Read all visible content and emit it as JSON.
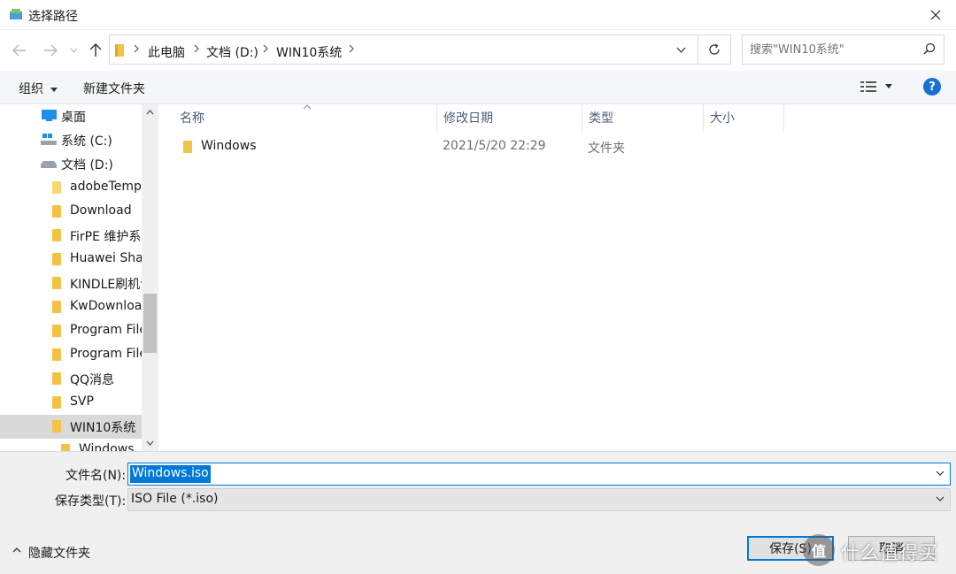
{
  "window": {
    "title": "选择路径"
  },
  "address": {
    "crumbs": [
      "此电脑",
      "文档 (D:)",
      "WIN10系统"
    ]
  },
  "search": {
    "placeholder": "搜索\"WIN10系统\""
  },
  "toolbar": {
    "organize": "组织",
    "new_folder": "新建文件夹",
    "help": "?"
  },
  "nav": {
    "items": [
      {
        "label": "桌面",
        "icon": "desktop-icon"
      },
      {
        "label": "系统 (C:)",
        "icon": "system-drive-icon"
      },
      {
        "label": "文档 (D:)",
        "icon": "drive-icon"
      },
      {
        "label": "adobeTemp",
        "icon": "folder-icon"
      },
      {
        "label": "Download",
        "icon": "folder-icon"
      },
      {
        "label": "FirPE 维护系统",
        "icon": "folder-icon"
      },
      {
        "label": "Huawei Share",
        "icon": "folder-icon"
      },
      {
        "label": "KINDLE刷机包",
        "icon": "folder-icon"
      },
      {
        "label": "KwDownload",
        "icon": "folder-icon"
      },
      {
        "label": "Program Files",
        "icon": "folder-icon"
      },
      {
        "label": "Program Files",
        "icon": "folder-icon"
      },
      {
        "label": "QQ消息",
        "icon": "folder-icon"
      },
      {
        "label": "SVP",
        "icon": "folder-icon"
      },
      {
        "label": "WIN10系统",
        "icon": "folder-icon",
        "selected": true
      },
      {
        "label": "Windows",
        "icon": "folder-icon"
      }
    ]
  },
  "columns": {
    "name": "名称",
    "modified": "修改日期",
    "type": "类型",
    "size": "大小"
  },
  "files": [
    {
      "name": "Windows",
      "modified": "2021/5/20 22:29",
      "type": "文件夹"
    }
  ],
  "form": {
    "filename_label": "文件名(N):",
    "filename_value": "Windows.iso",
    "filetype_label": "保存类型(T):",
    "filetype_value": "ISO File (*.iso)",
    "hide_folders": "隐藏文件夹",
    "save": "保存(S)",
    "cancel": "取消"
  },
  "watermark": {
    "text": "什么值得买",
    "badge": "值"
  },
  "colors": {
    "accent": "#0078d7",
    "help": "#1a6fd4",
    "folder": "#f3c346"
  }
}
